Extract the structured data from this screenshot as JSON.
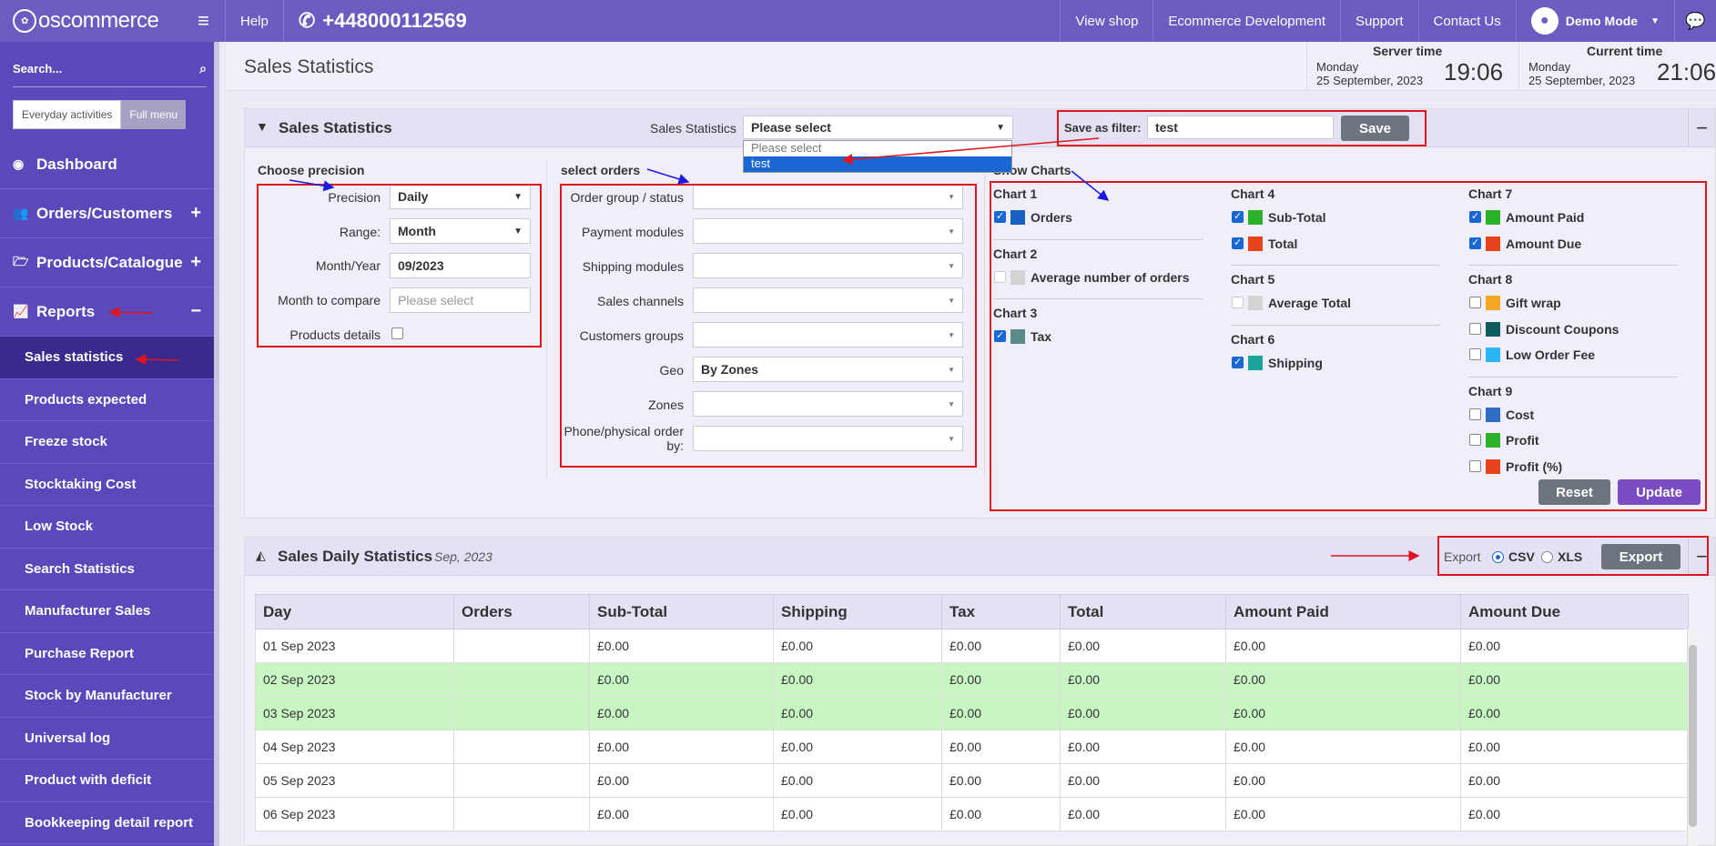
{
  "topbar": {
    "logo": "oscommerce",
    "help": "Help",
    "phone": "+448000112569",
    "links": [
      "View shop",
      "Ecommerce Development",
      "Support",
      "Contact Us"
    ],
    "user": "Demo Mode"
  },
  "sidebar": {
    "search_placeholder": "Search...",
    "mode_everyday": "Everyday activities",
    "mode_full": "Full menu",
    "nav": [
      {
        "label": "Dashboard",
        "icon": "dashboard-icon"
      },
      {
        "label": "Orders/Customers",
        "icon": "users-icon",
        "pm": "+"
      },
      {
        "label": "Products/Catalogue",
        "icon": "folder-icon",
        "pm": "+"
      },
      {
        "label": "Reports",
        "icon": "chart-line-icon",
        "pm": "−"
      }
    ],
    "reports": [
      "Sales statistics",
      "Products expected",
      "Freeze stock",
      "Stocktaking Cost",
      "Low Stock",
      "Search Statistics",
      "Manufacturer Sales",
      "Purchase Report",
      "Stock by Manufacturer",
      "Universal log",
      "Product with deficit",
      "Bookkeeping detail report"
    ]
  },
  "header": {
    "title": "Sales Statistics",
    "server_label": "Server time",
    "server_day": "Monday",
    "server_date": "25 September, 2023",
    "server_time": "19:06",
    "current_label": "Current time",
    "current_day": "Monday",
    "current_date": "25 September, 2023",
    "current_time": "21:06"
  },
  "filter": {
    "title": "Sales Statistics",
    "select_label": "Sales Statistics",
    "select_value": "Please select",
    "dropdown_options": [
      "Please select",
      "test"
    ],
    "save_label": "Save as filter:",
    "save_value": "test",
    "save_button": "Save"
  },
  "precision": {
    "heading": "Choose precision",
    "precision_label": "Precision",
    "precision_value": "Daily",
    "range_label": "Range:",
    "range_value": "Month",
    "month_label": "Month/Year",
    "month_value": "09/2023",
    "compare_label": "Month to compare",
    "compare_placeholder": "Please select",
    "products_label": "Products details"
  },
  "orders": {
    "heading": "select orders",
    "fields": [
      {
        "label": "Order group / status",
        "value": ""
      },
      {
        "label": "Payment modules",
        "value": ""
      },
      {
        "label": "Shipping modules",
        "value": ""
      },
      {
        "label": "Sales channels",
        "value": ""
      },
      {
        "label": "Customers groups",
        "value": ""
      },
      {
        "label": "Geo",
        "value": "By Zones"
      },
      {
        "label": "Zones",
        "value": ""
      },
      {
        "label": "Phone/physical order by:",
        "value": ""
      }
    ]
  },
  "charts": {
    "heading": "Show Charts",
    "groups": [
      {
        "title": "Chart 1",
        "items": [
          {
            "label": "Orders",
            "checked": true,
            "color": "#1a5fc2"
          }
        ]
      },
      {
        "title": "Chart 2",
        "items": [
          {
            "label": "Average number of orders",
            "checked": false,
            "color": "#d3d3d3"
          }
        ]
      },
      {
        "title": "Chart 3",
        "items": [
          {
            "label": "Tax",
            "checked": true,
            "color": "#5a8a8a"
          }
        ]
      },
      {
        "title": "Chart 4",
        "items": [
          {
            "label": "Sub-Total",
            "checked": true,
            "color": "#2ab02a"
          },
          {
            "label": "Total",
            "checked": true,
            "color": "#e8421a"
          }
        ]
      },
      {
        "title": "Chart 5",
        "items": [
          {
            "label": "Average Total",
            "checked": false,
            "color": "#d3d3d3"
          }
        ]
      },
      {
        "title": "Chart 6",
        "items": [
          {
            "label": "Shipping",
            "checked": true,
            "color": "#1aa39a"
          }
        ]
      },
      {
        "title": "Chart 7",
        "items": [
          {
            "label": "Amount Paid",
            "checked": true,
            "color": "#2ab02a"
          },
          {
            "label": "Amount Due",
            "checked": true,
            "color": "#e8421a"
          }
        ]
      },
      {
        "title": "Chart 8",
        "items": [
          {
            "label": "Gift wrap",
            "checked": false,
            "color": "#f5a623"
          },
          {
            "label": "Discount Coupons",
            "checked": false,
            "color": "#0f5c5c"
          },
          {
            "label": "Low Order Fee",
            "checked": false,
            "color": "#29b6f6"
          }
        ]
      },
      {
        "title": "Chart 9",
        "items": [
          {
            "label": "Cost",
            "checked": false,
            "color": "#2e6ec4"
          },
          {
            "label": "Profit",
            "checked": false,
            "color": "#2ab02a"
          },
          {
            "label": "Profit (%)",
            "checked": false,
            "color": "#e8421a"
          }
        ]
      }
    ],
    "reset": "Reset",
    "update": "Update"
  },
  "stats": {
    "title": "Sales Daily Statistics",
    "period": "Sep, 2023",
    "export_label": "Export",
    "csv": "CSV",
    "xls": "XLS",
    "export_button": "Export",
    "columns": [
      "Day",
      "Orders",
      "Sub-Total",
      "Shipping",
      "Tax",
      "Total",
      "Amount Paid",
      "Amount Due"
    ],
    "rows": [
      [
        "01 Sep 2023",
        "",
        "£0.00",
        "£0.00",
        "£0.00",
        "£0.00",
        "£0.00",
        "£0.00"
      ],
      [
        "02 Sep 2023",
        "",
        "£0.00",
        "£0.00",
        "£0.00",
        "£0.00",
        "£0.00",
        "£0.00"
      ],
      [
        "03 Sep 2023",
        "",
        "£0.00",
        "£0.00",
        "£0.00",
        "£0.00",
        "£0.00",
        "£0.00"
      ],
      [
        "04 Sep 2023",
        "",
        "£0.00",
        "£0.00",
        "£0.00",
        "£0.00",
        "£0.00",
        "£0.00"
      ],
      [
        "05 Sep 2023",
        "",
        "£0.00",
        "£0.00",
        "£0.00",
        "£0.00",
        "£0.00",
        "£0.00"
      ],
      [
        "06 Sep 2023",
        "",
        "£0.00",
        "£0.00",
        "£0.00",
        "£0.00",
        "£0.00",
        "£0.00"
      ]
    ]
  },
  "colors": {
    "brand": "#6a5cc0",
    "sidebar": "#5b48ba",
    "active": "#3b2a8e",
    "weekend": "#c8f6c2",
    "annotation_red": "#e0141e",
    "annotation_blue": "#1a1ae0"
  }
}
